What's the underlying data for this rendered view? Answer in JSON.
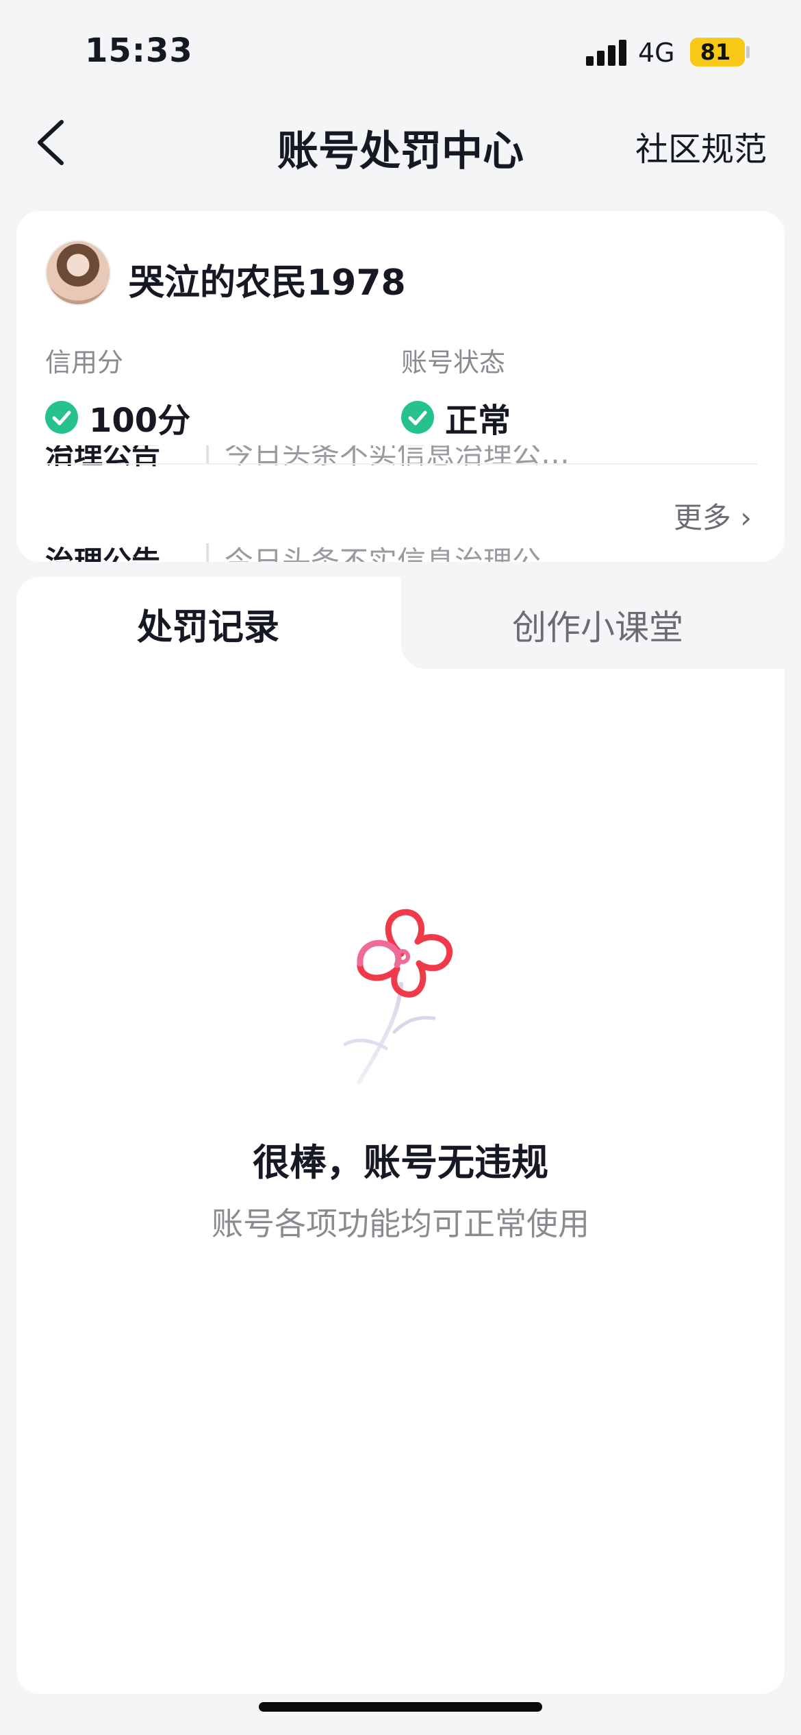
{
  "status_bar": {
    "time": "15:33",
    "network": "4G",
    "battery": "81"
  },
  "nav": {
    "title": "账号处罚中心",
    "right_link": "社区规范"
  },
  "profile": {
    "username": "哭泣的农民1978",
    "credit_label": "信用分",
    "credit_value": "100分",
    "status_label": "账号状态",
    "status_value": "正常"
  },
  "notices": {
    "title": "治理公告",
    "top_text": "今日头条不实信息治理公…",
    "bottom_text": "今日头条不实信息治理公",
    "more": "更多"
  },
  "tabs": [
    {
      "label": "处罚记录",
      "active": true
    },
    {
      "label": "创作小课堂",
      "active": false
    }
  ],
  "empty_state": {
    "title": "很棒，账号无违规",
    "subtitle": "账号各项功能均可正常使用"
  },
  "colors": {
    "check": "#25c28f",
    "battery": "#f7c815",
    "flower": "#f03a4a"
  }
}
